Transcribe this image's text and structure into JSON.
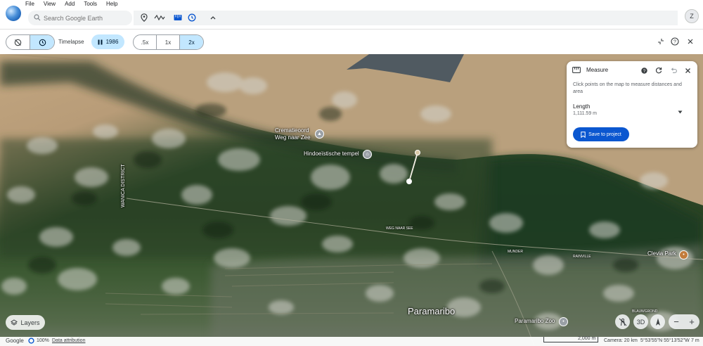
{
  "menu": [
    "File",
    "View",
    "Add",
    "Tools",
    "Help"
  ],
  "search": {
    "placeholder": "Search Google Earth"
  },
  "account": {
    "initial": "Z"
  },
  "timelapse": {
    "label": "Timelapse",
    "year": "1986",
    "speeds": [
      ".5x",
      "1x",
      "2x"
    ],
    "active_speed": "2x"
  },
  "measure": {
    "title": "Measure",
    "description": "Click points on the map to measure distances and area",
    "length_label": "Length",
    "length_value": "1,111.59 m",
    "save_label": "Save to project"
  },
  "map_labels": {
    "crematorium": "Crematieoord",
    "crematorium_line2": "Weg naar Zee",
    "temple": "Hindoeïstische tempel",
    "district": "WANICA DISTRICT",
    "road": "WEG NAAR SEE",
    "munder": "MUNDER",
    "rainville": "RAINVILLE",
    "clevia": "Clevia Park",
    "paramaribo": "Paramaribo",
    "zoo": "Paramaribo Zoo",
    "blauwgrond": "BLAUWGROND"
  },
  "controls": {
    "layers_label": "Layers",
    "three_d": "3D"
  },
  "status": {
    "brand": "Google",
    "percent": "100%",
    "data_attr": "Data attribution",
    "scale": "2,000 m",
    "camera": "Camera: 20 km",
    "coords": "5°53'55\"N 55°13'52\"W",
    "elev": "7 m"
  },
  "colors": {
    "accent": "#0b57d0",
    "active_bg": "#c2e7ff"
  }
}
